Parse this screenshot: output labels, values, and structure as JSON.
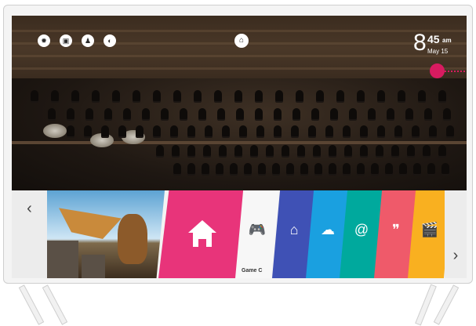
{
  "statusbar": {
    "time_hour": "8",
    "time_minute": "45",
    "ampm": "am",
    "date": "May 15"
  },
  "top_icons": [
    "settings-icon",
    "input-icon",
    "notification-icon",
    "search-icon"
  ],
  "launcher": {
    "left_arrow": "‹",
    "right_arrow": "›",
    "game_label": "Game C",
    "tiles": [
      {
        "name": "gamepad-icon",
        "color": "#f7f7f7",
        "glyph": "🎮"
      },
      {
        "name": "home-dashboard-icon",
        "color": "#3f51b5",
        "glyph": "⌂"
      },
      {
        "name": "cloud-icon",
        "color": "#1aa0e0",
        "glyph": "☁"
      },
      {
        "name": "at-icon",
        "color": "#00a99d",
        "glyph": "@"
      },
      {
        "name": "chat-icon",
        "color": "#ef5a6a",
        "glyph": "❞"
      },
      {
        "name": "clapper-icon",
        "color": "#f9b020",
        "glyph": "🎬"
      }
    ]
  },
  "colors": {
    "accent": "#d81b60",
    "home_tile": "#e8347a"
  }
}
